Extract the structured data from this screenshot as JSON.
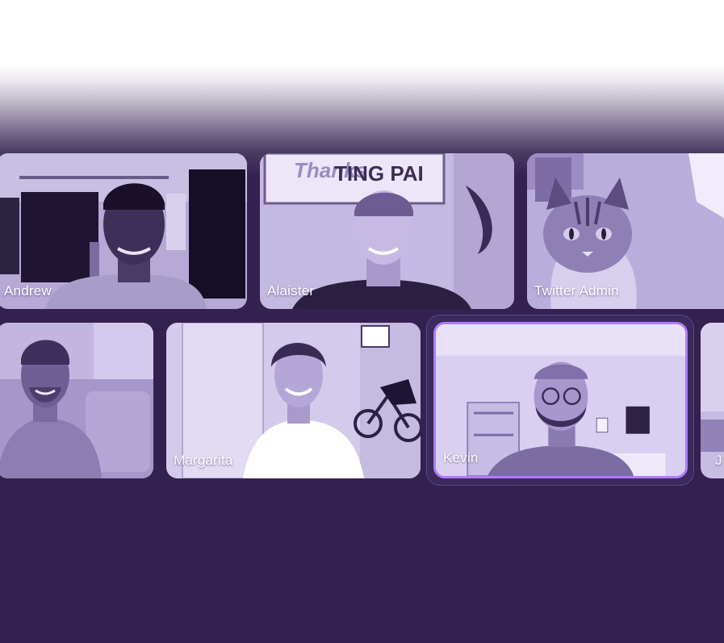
{
  "colors": {
    "background": "#33214f",
    "tile_tint": "#8f80b3",
    "active_border": "#b07bff",
    "name_text": "#ffffff"
  },
  "participants": [
    {
      "name": "Andrew",
      "active": false
    },
    {
      "name": "Alaister",
      "active": false
    },
    {
      "name": "Twitter Admin",
      "active": false
    },
    {
      "name": "",
      "active": false
    },
    {
      "name": "Margarita",
      "active": false
    },
    {
      "name": "Kevin",
      "active": true
    },
    {
      "name": "J",
      "active": false
    }
  ],
  "poster_text": "TING PAI"
}
